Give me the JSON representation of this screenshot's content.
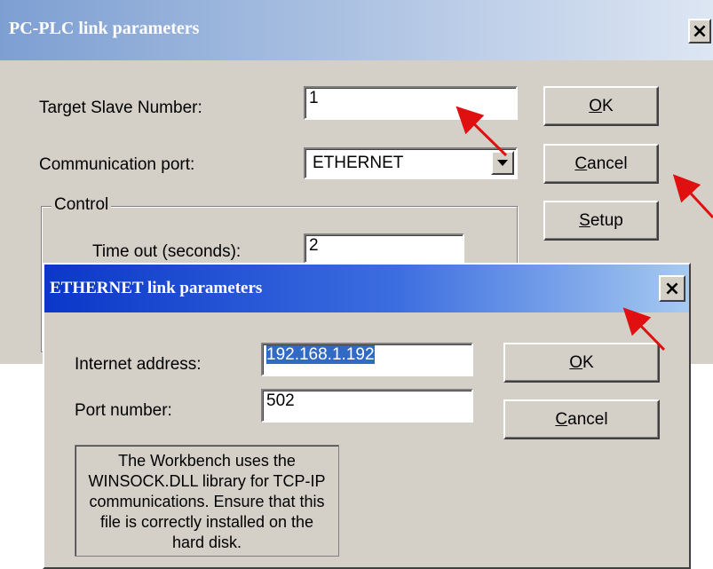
{
  "plc_dialog": {
    "title": "PC-PLC link parameters",
    "close_glyph": "×",
    "target_slave_label": "Target Slave Number:",
    "target_slave_value": "1",
    "comm_port_label": "Communication port:",
    "comm_port_value": "ETHERNET",
    "control_group_label": "Control",
    "timeout_label": "Time out (seconds):",
    "timeout_value": "2",
    "ok_button": {
      "mnemonic": "O",
      "rest": "K"
    },
    "cancel_button": {
      "mnemonic": "C",
      "rest": "ancel"
    },
    "setup_button": {
      "mnemonic": "S",
      "rest": "etup"
    }
  },
  "ethernet_dialog": {
    "title": "ETHERNET link parameters",
    "close_glyph": "×",
    "internet_address_label": "Internet address:",
    "internet_address_value": "192.168.1.192",
    "port_number_label": "Port number:",
    "port_number_value": "502",
    "ok_button": {
      "mnemonic": "O",
      "rest": "K"
    },
    "cancel_button": {
      "mnemonic": "C",
      "rest": "ancel"
    },
    "info_text": "The Workbench uses the WINSOCK.DLL library for TCP-IP communications. Ensure that this file is correctly installed on the hard disk."
  },
  "colors": {
    "plc_title_gradient_start": "#7d9fd2",
    "plc_title_gradient_end": "#d6e0f0",
    "eth_title_gradient_start": "#0a37c8",
    "eth_title_gradient_end": "#a6caf0",
    "selection": "#316ac5",
    "annotation_arrow": "#e01010"
  }
}
